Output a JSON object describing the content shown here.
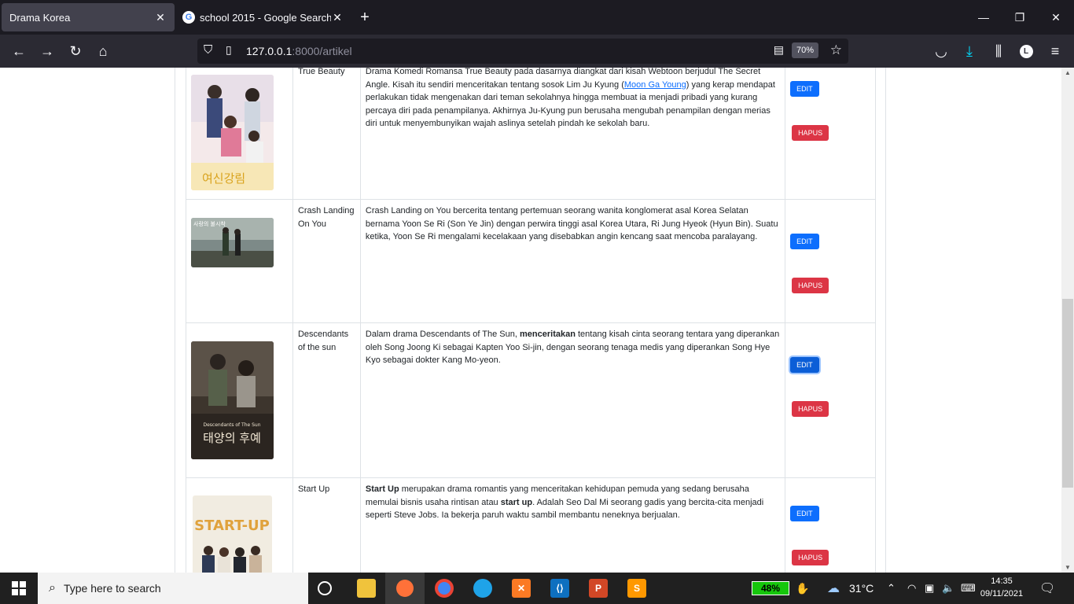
{
  "browser": {
    "tabs": [
      {
        "label": "Drama Korea",
        "active": true
      },
      {
        "label": "school 2015 - Google Search",
        "active": false
      }
    ],
    "url_host": "127.0.0.1",
    "url_rest": ":8000/artikel",
    "zoom": "70%"
  },
  "dramas": [
    {
      "title": "True Beauty",
      "desc_before": "Drama Komedi Romansa True Beauty pada dasarnya diangkat dari kisah Webtoon berjudul The Secret Angle. Kisah itu sendiri menceritakan tentang sosok Lim Ju Kyung (",
      "desc_link": "Moon Ga Young",
      "desc_after": ") yang kerap mendapat perlakukan tidak mengenakan dari teman sekolahnya hingga membuat ia menjadi pribadi yang kurang percaya diri pada penampilanya. Akhirnya Ju-Kyung pun berusaha mengubah penampilan dengan merias diri untuk menyembunyikan wajah aslinya setelah pindah ke sekolah baru.",
      "edit_label": "EDIT",
      "delete_label": "HAPUS"
    },
    {
      "title": "Crash Landing On You",
      "desc": "Crash Landing on You bercerita tentang pertemuan seorang wanita konglomerat asal Korea Selatan bernama Yoon Se Ri (Son Ye Jin) dengan perwira tinggi asal Korea Utara, Ri Jung Hyeok (Hyun Bin). Suatu ketika, Yoon Se Ri mengalami kecelakaan yang disebabkan angin kencang saat mencoba paralayang.",
      "edit_label": "EDIT",
      "delete_label": "HAPUS"
    },
    {
      "title": "Descendants of the sun",
      "desc_before": "Dalam drama Descendants of The Sun, ",
      "desc_bold": "menceritakan",
      "desc_after": " tentang kisah cinta seorang tentara yang diperankan oleh Song Joong Ki sebagai Kapten Yoo Si-jin, dengan seorang tenaga medis yang diperankan Song Hye Kyo sebagai dokter Kang Mo-yeon.",
      "poster_caption": "Descendants of The Sun",
      "edit_label": "EDIT",
      "delete_label": "HAPUS"
    },
    {
      "title": "Start Up",
      "desc_bold1": "Start Up",
      "desc_mid1": " merupakan drama romantis yang menceritakan kehidupan pemuda yang sedang berusaha memulai bisnis usaha rintisan atau ",
      "desc_bold2": "start up",
      "desc_after": ". Adalah Seo Dal Mi seorang gadis yang bercita-cita menjadi seperti Steve Jobs. Ia bekerja paruh waktu sambil membantu neneknya berjualan.",
      "poster_caption": "START-UP",
      "edit_label": "EDIT",
      "delete_label": "HAPUS"
    }
  ],
  "taskbar": {
    "search_placeholder": "Type here to search",
    "battery": "48%",
    "temperature": "31°C",
    "time": "14:35",
    "date": "09/11/2021"
  }
}
